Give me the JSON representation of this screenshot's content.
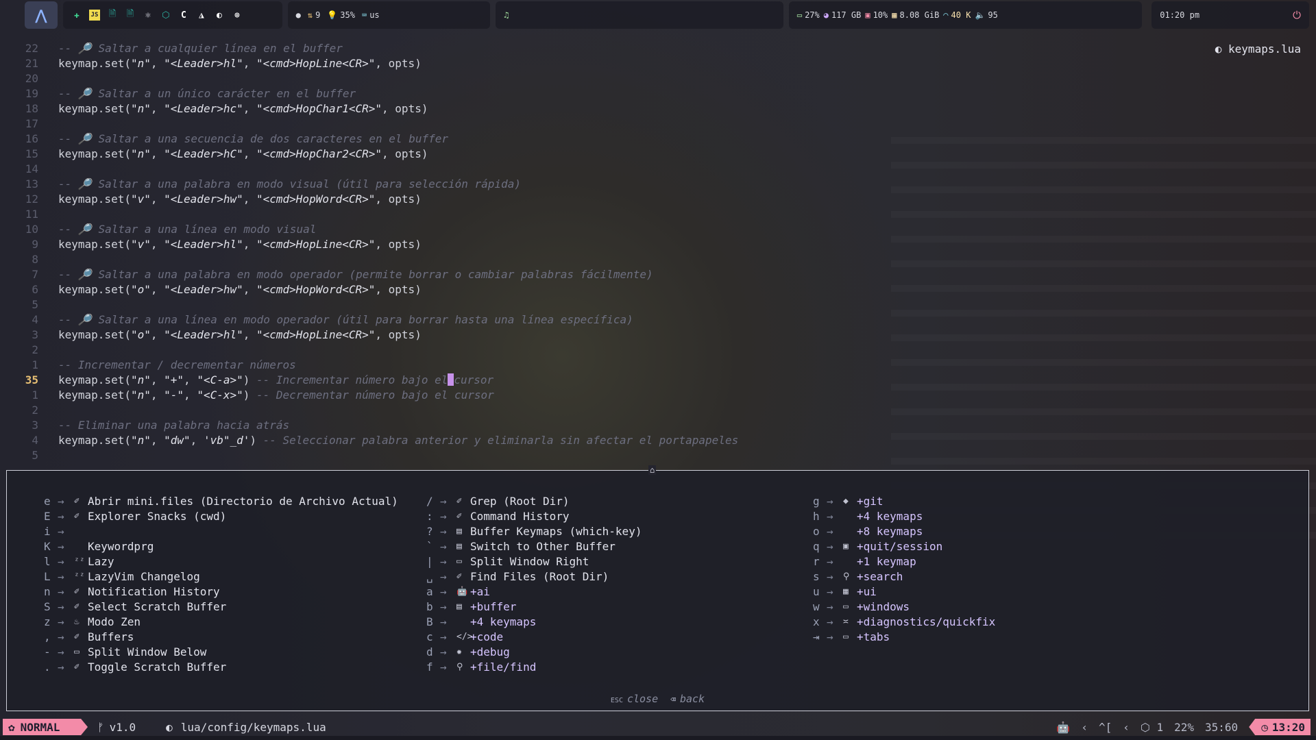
{
  "topbar": {
    "arch_glyph": "⋀",
    "apps": [
      "✚",
      "JS",
      "🗎",
      "🗎",
      "⚛",
      "⬡",
      "C",
      "◮",
      "◐",
      "⊛"
    ],
    "stats1": {
      "updates": "9",
      "brightness": "35%",
      "keyboard": "us"
    },
    "media_glyph": "♫",
    "stats2": {
      "battery": "27%",
      "disk": "117 GB",
      "cpu": "10%",
      "memory": "8.08 GiB",
      "network": "40 K",
      "volume": "95"
    },
    "clock": "01:20 pm",
    "power_glyph": "⏻"
  },
  "editor": {
    "filename": "keymaps.lua",
    "lines": [
      {
        "n": "22",
        "comment": "-- 🔎 Saltar a cualquier línea en el buffer"
      },
      {
        "n": "21",
        "code": [
          "keymap.set(",
          "\"n\"",
          ", ",
          "\"<Leader>hl\"",
          ", ",
          "\"<cmd>HopLine<CR>\"",
          ", opts)"
        ]
      },
      {
        "n": "20"
      },
      {
        "n": "19",
        "comment": "-- 🔎 Saltar a un único carácter en el buffer"
      },
      {
        "n": "18",
        "code": [
          "keymap.set(",
          "\"n\"",
          ", ",
          "\"<Leader>hc\"",
          ", ",
          "\"<cmd>HopChar1<CR>\"",
          ", opts)"
        ]
      },
      {
        "n": "17"
      },
      {
        "n": "16",
        "comment": "-- 🔎 Saltar a una secuencia de dos caracteres en el buffer"
      },
      {
        "n": "15",
        "code": [
          "keymap.set(",
          "\"n\"",
          ", ",
          "\"<Leader>hC\"",
          ", ",
          "\"<cmd>HopChar2<CR>\"",
          ", opts)"
        ]
      },
      {
        "n": "14"
      },
      {
        "n": "13",
        "comment": "-- 🔎 Saltar a una palabra en modo visual (útil para selección rápida)"
      },
      {
        "n": "12",
        "code": [
          "keymap.set(",
          "\"v\"",
          ", ",
          "\"<Leader>hw\"",
          ", ",
          "\"<cmd>HopWord<CR>\"",
          ", opts)"
        ]
      },
      {
        "n": "11"
      },
      {
        "n": "10",
        "comment": "-- 🔎 Saltar a una línea en modo visual"
      },
      {
        "n": "9",
        "code": [
          "keymap.set(",
          "\"v\"",
          ", ",
          "\"<Leader>hl\"",
          ", ",
          "\"<cmd>HopLine<CR>\"",
          ", opts)"
        ]
      },
      {
        "n": "8"
      },
      {
        "n": "7",
        "comment": "-- 🔎 Saltar a una palabra en modo operador (permite borrar o cambiar palabras fácilmente)"
      },
      {
        "n": "6",
        "code": [
          "keymap.set(",
          "\"o\"",
          ", ",
          "\"<Leader>hw\"",
          ", ",
          "\"<cmd>HopWord<CR>\"",
          ", opts)"
        ]
      },
      {
        "n": "5"
      },
      {
        "n": "4",
        "comment": "-- 🔎 Saltar a una línea en modo operador (útil para borrar hasta una línea específica)"
      },
      {
        "n": "3",
        "code": [
          "keymap.set(",
          "\"o\"",
          ", ",
          "\"<Leader>hl\"",
          ", ",
          "\"<cmd>HopLine<CR>\"",
          ", opts)"
        ]
      },
      {
        "n": "2"
      },
      {
        "n": "1",
        "comment": "-- Incrementar / decrementar números"
      },
      {
        "n": "35",
        "current": true,
        "code": [
          "keymap.set(",
          "\"n\"",
          ", ",
          "\"+\"",
          ", ",
          "\"<C-a>\"",
          ") "
        ],
        "tail_comment_a": "-- Incrementar número bajo el",
        "tail_comment_b": "cursor"
      },
      {
        "n": "1",
        "code": [
          "keymap.set(",
          "\"n\"",
          ", ",
          "\"-\"",
          ", ",
          "\"<C-x>\"",
          ") "
        ],
        "tail_comment": "-- Decrementar número bajo el cursor"
      },
      {
        "n": "2"
      },
      {
        "n": "3",
        "comment": "-- Eliminar una palabra hacia atrás"
      },
      {
        "n": "4",
        "code": [
          "keymap.set(",
          "\"n\"",
          ", ",
          "\"dw\"",
          ", ",
          "'vb\"_d'",
          ") "
        ],
        "tail_comment": "-- Seleccionar palabra anterior y eliminarla sin afectar el portapapeles"
      },
      {
        "n": "5"
      }
    ]
  },
  "whichkey": {
    "top_mark": "⌂",
    "col1": [
      {
        "key": "e",
        "icon": "✐",
        "label": "Abrir mini.files (Directorio de Archivo Actual)"
      },
      {
        "key": "E",
        "icon": "✐",
        "label": "Explorer Snacks (cwd)"
      },
      {
        "key": "i",
        "icon": "",
        "label": ""
      },
      {
        "key": "K",
        "icon": "",
        "label": "Keywordprg"
      },
      {
        "key": "l",
        "icon": "ᶻᶻ",
        "label": "Lazy"
      },
      {
        "key": "L",
        "icon": "ᶻᶻ",
        "label": "LazyVim Changelog"
      },
      {
        "key": "n",
        "icon": "✐",
        "label": "Notification History"
      },
      {
        "key": "S",
        "icon": "✐",
        "label": "Select Scratch Buffer"
      },
      {
        "key": "z",
        "icon": "♨",
        "label": "Modo Zen"
      },
      {
        "key": ",",
        "icon": "✐",
        "label": "Buffers"
      },
      {
        "key": "-",
        "icon": "▭",
        "label": "Split Window Below"
      },
      {
        "key": ".",
        "icon": "✐",
        "label": "Toggle Scratch Buffer"
      }
    ],
    "col2": [
      {
        "key": "/",
        "icon": "✐",
        "label": "Grep (Root Dir)"
      },
      {
        "key": ":",
        "icon": "✐",
        "label": "Command History"
      },
      {
        "key": "?",
        "icon": "▤",
        "label": "Buffer Keymaps (which-key)"
      },
      {
        "key": "`",
        "icon": "▤",
        "label": "Switch to Other Buffer"
      },
      {
        "key": "|",
        "icon": "▭",
        "label": "Split Window Right"
      },
      {
        "key": "␣",
        "icon": "✐",
        "label": "Find Files (Root Dir)"
      },
      {
        "key": "a",
        "icon": "🤖",
        "label": "+ai",
        "group": true
      },
      {
        "key": "b",
        "icon": "▤",
        "label": "+buffer",
        "group": true
      },
      {
        "key": "B",
        "icon": "",
        "label": "+4 keymaps",
        "group": true
      },
      {
        "key": "c",
        "icon": "</>",
        "label": "+code",
        "group": true
      },
      {
        "key": "d",
        "icon": "✹",
        "label": "+debug",
        "group": true
      },
      {
        "key": "f",
        "icon": "⚲",
        "label": "+file/find",
        "group": true
      }
    ],
    "col3": [
      {
        "key": "g",
        "icon": "◆",
        "label": "+git",
        "group": true
      },
      {
        "key": "h",
        "icon": "",
        "label": "+4 keymaps",
        "group": true
      },
      {
        "key": "o",
        "icon": "",
        "label": "+8 keymaps",
        "group": true
      },
      {
        "key": "q",
        "icon": "▣",
        "label": "+quit/session",
        "group": true
      },
      {
        "key": "r",
        "icon": "",
        "label": "+1 keymap",
        "group": true
      },
      {
        "key": "s",
        "icon": "⚲",
        "label": "+search",
        "group": true
      },
      {
        "key": "u",
        "icon": "▦",
        "label": "+ui",
        "group": true
      },
      {
        "key": "w",
        "icon": "▭",
        "label": "+windows",
        "group": true
      },
      {
        "key": "x",
        "icon": "≍",
        "label": "+diagnostics/quickfix",
        "group": true
      },
      {
        "key": "⇥",
        "icon": "▭",
        "label": "+tabs",
        "group": true
      }
    ],
    "footer": {
      "close_key": "ESC",
      "close_label": "close",
      "back_key": "⌫",
      "back_label": "back"
    }
  },
  "statusline": {
    "mode_icon": "✿",
    "mode": "NORMAL",
    "branch_icon": "ᚠ",
    "branch": "v1.0",
    "file_icon": "◐",
    "path": "lua/config/keymaps.lua",
    "right": {
      "ai_icon": "🤖",
      "keys": "^[",
      "pkg_count": "1",
      "percent": "22%",
      "position": "35:60",
      "time": "13:20"
    }
  },
  "colors": {
    "accent": "#f38ba8",
    "cursor": "#c792ea"
  }
}
